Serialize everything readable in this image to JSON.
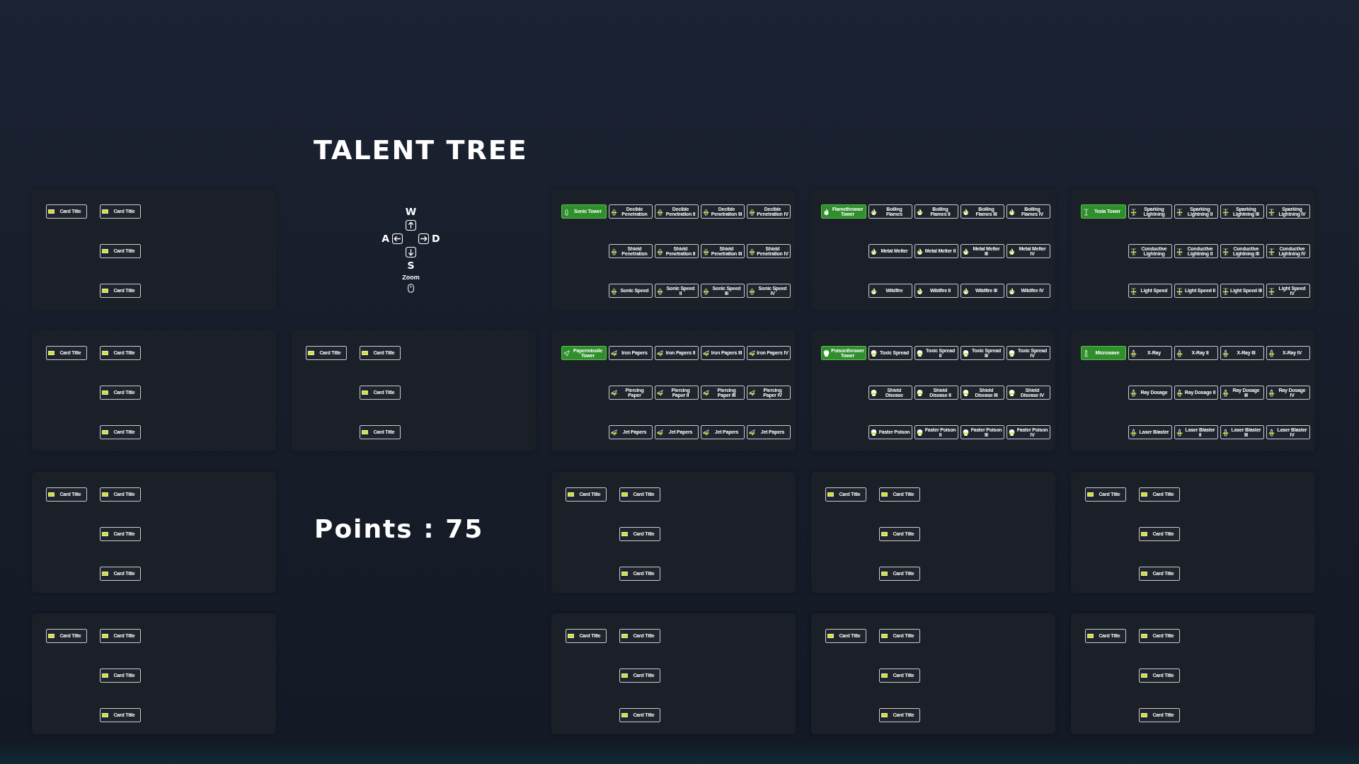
{
  "title": "TALENT TREE",
  "cells": [
    {
      "kind": "generic",
      "cards": [
        {
          "title": "Card Title"
        },
        {
          "title": "Card Title"
        },
        {
          "title": "Card Title"
        },
        {
          "title": "Card Title"
        }
      ]
    },
    {
      "kind": "controls",
      "up": "W",
      "left": "A",
      "right": "D",
      "down": "S",
      "zoom": "Zoom"
    },
    {
      "kind": "talent",
      "tower": {
        "title": "Sonic Tower"
      },
      "rows": [
        [
          {
            "title": "Decible Penetration"
          },
          {
            "title": "Decible Penetration II"
          },
          {
            "title": "Decible Penetration III"
          },
          {
            "title": "Decible Penetration IV"
          }
        ],
        [
          {
            "title": "Shield Penetration"
          },
          {
            "title": "Shield Penetration II"
          },
          {
            "title": "Shield Penetration III"
          },
          {
            "title": "Shield Penetration IV"
          }
        ],
        [
          {
            "title": "Sonic Speed"
          },
          {
            "title": "Sonic Speed II"
          },
          {
            "title": "Sonic Speed III"
          },
          {
            "title": "Sonic Speed IV"
          }
        ]
      ]
    },
    {
      "kind": "talent",
      "tower": {
        "title": "Flamethrower Tower"
      },
      "rows": [
        [
          {
            "title": "Boiling Flames"
          },
          {
            "title": "Boiling Flames II"
          },
          {
            "title": "Boiling Flames III"
          },
          {
            "title": "Boiling Flames IV"
          }
        ],
        [
          {
            "title": "Metal Melter"
          },
          {
            "title": "Metal Melter II"
          },
          {
            "title": "Metal Melter III"
          },
          {
            "title": "Metal Melter IV"
          }
        ],
        [
          {
            "title": "Wildfire"
          },
          {
            "title": "Wildfire II"
          },
          {
            "title": "Wildfire III"
          },
          {
            "title": "Wildfire IV"
          }
        ]
      ]
    },
    {
      "kind": "talent",
      "tower": {
        "title": "Tesla Tower"
      },
      "rows": [
        [
          {
            "title": "Sparking Lightning"
          },
          {
            "title": "Sparking Lightning II"
          },
          {
            "title": "Sparking Lightning III"
          },
          {
            "title": "Sparking Lightning IV"
          }
        ],
        [
          {
            "title": "Conductive Lightning"
          },
          {
            "title": "Conductive Lightning II"
          },
          {
            "title": "Conductive Lightning III"
          },
          {
            "title": "Conductive Lightning IV"
          }
        ],
        [
          {
            "title": "Light Speed"
          },
          {
            "title": "Light Speed II"
          },
          {
            "title": "Light Speed III"
          },
          {
            "title": "Light Speed IV"
          }
        ]
      ]
    },
    {
      "kind": "generic",
      "cards": [
        {
          "title": "Card Title"
        },
        {
          "title": "Card Title"
        },
        {
          "title": "Card Title"
        },
        {
          "title": "Card Title"
        }
      ]
    },
    {
      "kind": "generic",
      "cards": [
        {
          "title": "Card Title"
        },
        {
          "title": "Card Title"
        },
        {
          "title": "Card Title"
        },
        {
          "title": "Card Title"
        }
      ]
    },
    {
      "kind": "talent",
      "tower": {
        "title": "Papermissile Tower"
      },
      "rows": [
        [
          {
            "title": "Iron Papers"
          },
          {
            "title": "Iron Papers II"
          },
          {
            "title": "Iron Papers III"
          },
          {
            "title": "Iron Papers IV"
          }
        ],
        [
          {
            "title": "Piercing Paper"
          },
          {
            "title": "Piercing Paper II"
          },
          {
            "title": "Piercing Paper III"
          },
          {
            "title": "Piercing Paper IV"
          }
        ],
        [
          {
            "title": "Jet Papers"
          },
          {
            "title": "Jet Papers"
          },
          {
            "title": "Jet Papers"
          },
          {
            "title": "Jet Papers"
          }
        ]
      ]
    },
    {
      "kind": "talent",
      "tower": {
        "title": "Poisonthrower Tower"
      },
      "rows": [
        [
          {
            "title": "Toxic Spread"
          },
          {
            "title": "Toxic Spread II"
          },
          {
            "title": "Toxic Spread III"
          },
          {
            "title": "Toxic Spread IV"
          }
        ],
        [
          {
            "title": "Shield Disease"
          },
          {
            "title": "Shield Disease II"
          },
          {
            "title": "Shield Disease III"
          },
          {
            "title": "Shield Disease IV"
          }
        ],
        [
          {
            "title": "Faster Poison"
          },
          {
            "title": "Faster Poison II"
          },
          {
            "title": "Faster Poison III"
          },
          {
            "title": "Faster Poison IV"
          }
        ]
      ]
    },
    {
      "kind": "talent",
      "tower": {
        "title": "Microwave"
      },
      "rows": [
        [
          {
            "title": "X-Ray"
          },
          {
            "title": "X-Ray II"
          },
          {
            "title": "X-Ray III"
          },
          {
            "title": "X-Ray IV"
          }
        ],
        [
          {
            "title": "Ray Dosage"
          },
          {
            "title": "Ray Dosage II"
          },
          {
            "title": "Ray Dosage III"
          },
          {
            "title": "Ray Dosage IV"
          }
        ],
        [
          {
            "title": "Laser Blaster"
          },
          {
            "title": "Laser Blaster II"
          },
          {
            "title": "Laser Blaster III"
          },
          {
            "title": "Laser Blaster IV"
          }
        ]
      ]
    },
    {
      "kind": "generic",
      "cards": [
        {
          "title": "Card Title"
        },
        {
          "title": "Card Title"
        },
        {
          "title": "Card Title"
        },
        {
          "title": "Card Title"
        }
      ]
    },
    {
      "kind": "points",
      "text": "Points : 75"
    },
    {
      "kind": "generic",
      "cards": [
        {
          "title": "Card Title"
        },
        {
          "title": "Card Title"
        },
        {
          "title": "Card Title"
        },
        {
          "title": "Card Title"
        }
      ]
    },
    {
      "kind": "generic",
      "cards": [
        {
          "title": "Card Title"
        },
        {
          "title": "Card Title"
        },
        {
          "title": "Card Title"
        },
        {
          "title": "Card Title"
        }
      ]
    },
    {
      "kind": "generic",
      "cards": [
        {
          "title": "Card Title"
        },
        {
          "title": "Card Title"
        },
        {
          "title": "Card Title"
        },
        {
          "title": "Card Title"
        }
      ]
    },
    {
      "kind": "generic",
      "cards": [
        {
          "title": "Card Title"
        },
        {
          "title": "Card Title"
        },
        {
          "title": "Card Title"
        },
        {
          "title": "Card Title"
        }
      ]
    },
    {
      "kind": "empty"
    },
    {
      "kind": "generic",
      "cards": [
        {
          "title": "Card Title"
        },
        {
          "title": "Card Title"
        },
        {
          "title": "Card Title"
        },
        {
          "title": "Card Title"
        }
      ]
    },
    {
      "kind": "generic",
      "cards": [
        {
          "title": "Card Title"
        },
        {
          "title": "Card Title"
        },
        {
          "title": "Card Title"
        },
        {
          "title": "Card Title"
        }
      ]
    },
    {
      "kind": "generic",
      "cards": [
        {
          "title": "Card Title"
        },
        {
          "title": "Card Title"
        },
        {
          "title": "Card Title"
        },
        {
          "title": "Card Title"
        }
      ]
    }
  ]
}
